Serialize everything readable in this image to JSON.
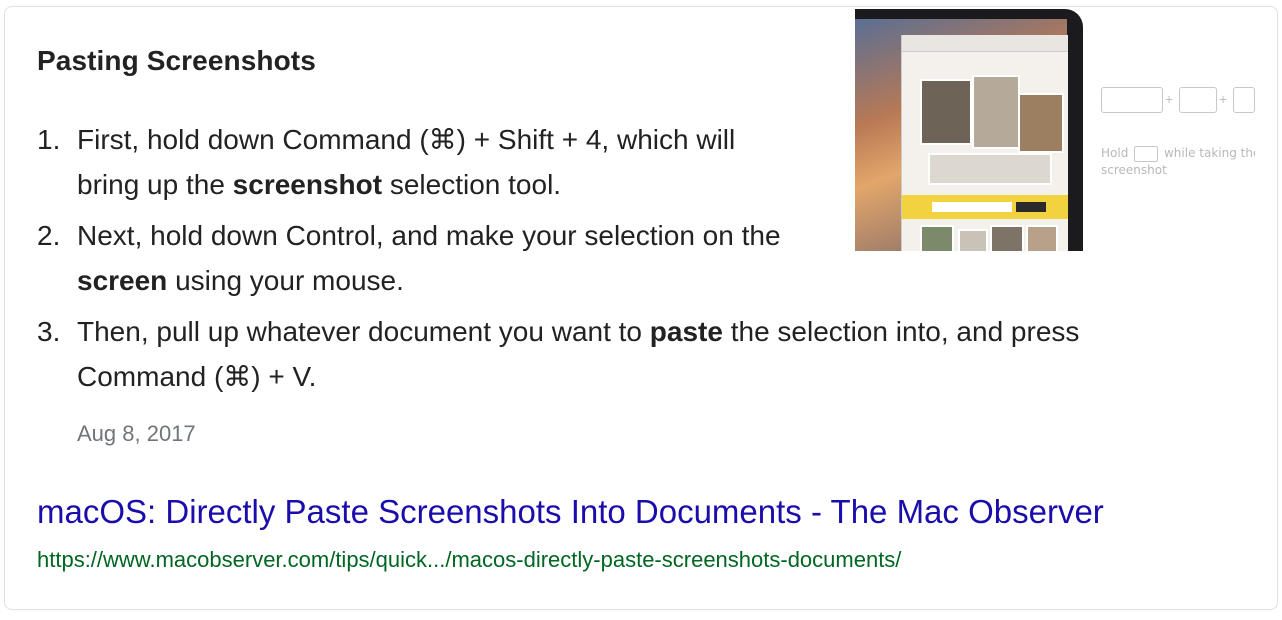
{
  "card": {
    "title": "Pasting Screenshots",
    "steps": [
      {
        "num": "1.",
        "parts": [
          "First, hold down Command (⌘) + Shift + 4, which will bring up the ",
          "screenshot",
          " selection tool."
        ]
      },
      {
        "num": "2.",
        "parts": [
          "Next, hold down Control, and make your selection on the ",
          "screen",
          " using your mouse."
        ]
      },
      {
        "num": "3.",
        "parts": [
          "Then, pull up whatever document you want to ",
          "paste",
          " the selection into, and press Command (⌘) + V."
        ]
      }
    ],
    "date": "Aug 8, 2017",
    "result_title": "macOS: Directly Paste Screenshots Into Documents - The Mac Observer",
    "result_url": "https://www.macobserver.com/tips/quick.../macos-directly-paste-screenshots-documents/",
    "thumbnail": {
      "hold_word": "Hold",
      "hold_rest": "while taking the screenshot",
      "plus": "+"
    }
  },
  "colors": {
    "link": "#1a0dab",
    "url": "#006621",
    "date": "#70757a",
    "text": "#222222"
  }
}
